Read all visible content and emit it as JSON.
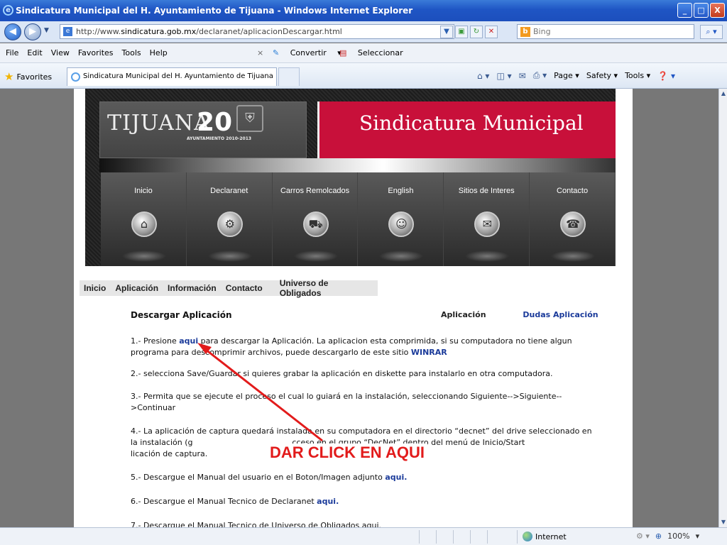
{
  "window": {
    "title": "Sindicatura Municipal del H. Ayuntamiento de Tijuana - Windows Internet Explorer",
    "controls": [
      "_",
      "□",
      "X"
    ]
  },
  "address": {
    "url_prefix": "http://www.",
    "url_domain": "sindicatura.gob.mx",
    "url_path": "/declaranet/aplicacionDescargar.html",
    "search_placeholder": "Bing"
  },
  "menu": {
    "items": [
      "File",
      "Edit",
      "View",
      "Favorites",
      "Tools",
      "Help"
    ],
    "close": "×",
    "convertir": "Convertir",
    "seleccionar": "Seleccionar"
  },
  "favorites": {
    "label": "Favorites",
    "tab_title": "Sindicatura Municipal del H. Ayuntamiento de Tijuana",
    "commands": [
      "Page",
      "Safety",
      "Tools"
    ]
  },
  "site": {
    "logo_main": "TIJUANA",
    "logo_number": "20",
    "logo_sub": "AYUNTAMIENTO 2010-2013",
    "banner_title": "Sindicatura Municipal",
    "nav": [
      {
        "label": "Inicio"
      },
      {
        "label": "Declaranet"
      },
      {
        "label": "Carros Remolcados"
      },
      {
        "label": "English"
      },
      {
        "label": "Sitios de Interes"
      },
      {
        "label": "Contacto"
      }
    ],
    "subnav": [
      "Inicio",
      "Aplicación",
      "Información",
      "Contacto",
      "Universo de Obligados"
    ]
  },
  "download": {
    "title": "Descargar Aplicación",
    "link1": "Aplicación",
    "link2": "Dudas Aplicación",
    "p1_a": "1.- Presione ",
    "p1_link": "aqui",
    "p1_b": " para descargar la Aplicación. La aplicacion esta comprimida, si su computadora no tiene algun programa para descomprimir archivos, puede descargarlo de este sitio ",
    "p1_link2": "WINRAR",
    "p2": "2.- selecciona Save/Guardar si quieres grabar la aplicación en diskette para instalarlo en otra computadora.",
    "p3": "3.- Permita que se ejecute el proceso el cual lo guiará en la instalación, seleccionando Siguiente-->Siguiente-->Continuar",
    "p4": "4.- La aplicación de captura quedará instalada en su computadora en el directorio “decnet” del drive seleccionado en la instalación (g                                        cceso en el grupo “DecNet” dentro del menú de Inicio/Start                                                      licación de captura.",
    "p5_a": "5.- Descargue el Manual del usuario en el Boton/Imagen adjunto ",
    "p5_link": "aqui.",
    "p6_a": "6.- Descargue el Manual Tecnico de Declaranet ",
    "p6_link": "aqui.",
    "p7": "7.- Descargue el Manual Tecnico de Universo de Obligados aqui.",
    "annotation": "DAR CLICK EN AQUI"
  },
  "status": {
    "zone": "Internet",
    "zoom": "100%"
  },
  "colors": {
    "brand_red": "#c8103a",
    "annotation_red": "#e21b1b",
    "link_blue": "#1a3a9a"
  }
}
